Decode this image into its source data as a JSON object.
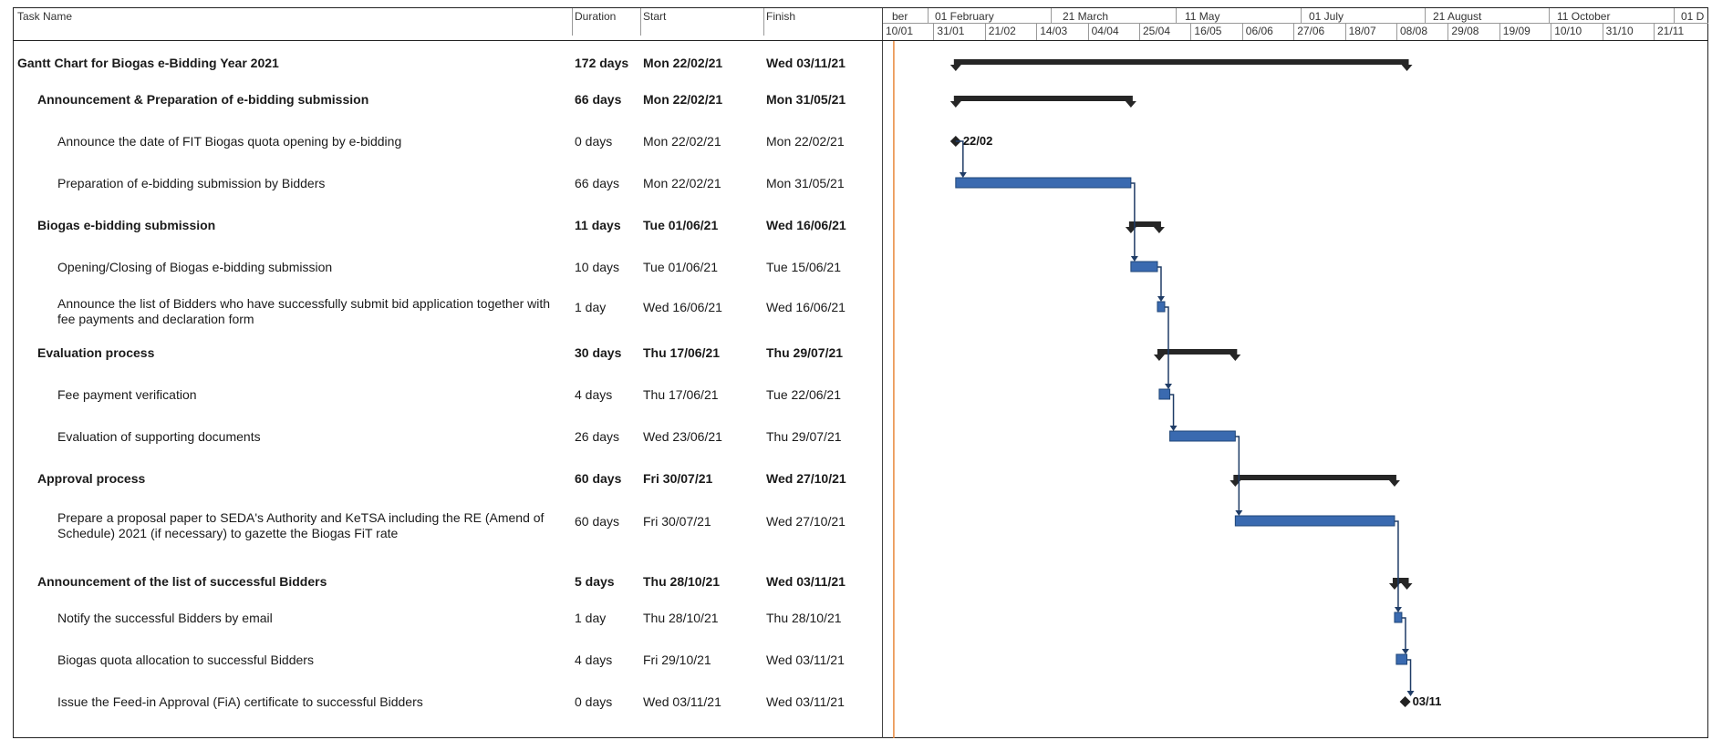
{
  "page_caption": "",
  "columns": {
    "task_name": "Task Name",
    "duration": "Duration",
    "start": "Start",
    "finish": "Finish"
  },
  "timescale": {
    "major": [
      "ber",
      "01 February",
      "21 March",
      "11 May",
      "01 July",
      "21 August",
      "11 October",
      "01 D"
    ],
    "minor": [
      "10/01",
      "31/01",
      "21/02",
      "14/03",
      "04/04",
      "25/04",
      "16/05",
      "06/06",
      "27/06",
      "18/07",
      "08/08",
      "29/08",
      "19/09",
      "10/10",
      "31/10",
      "21/11"
    ]
  },
  "chart_data": {
    "type": "gantt",
    "title": "Gantt Chart for Biogas e-Bidding Year 2021",
    "tasks": [
      {
        "name": "Gantt Chart for Biogas e-Bidding Year 2021",
        "duration": "172 days",
        "start": "Mon 22/02/21",
        "finish": "Wed 03/11/21",
        "level": 0,
        "kind": "summary",
        "start_date": "2021-02-22",
        "finish_date": "2021-11-03"
      },
      {
        "name": "Announcement & Preparation of e-bidding submission",
        "duration": "66 days",
        "start": "Mon 22/02/21",
        "finish": "Mon 31/05/21",
        "level": 1,
        "kind": "summary",
        "start_date": "2021-02-22",
        "finish_date": "2021-05-31"
      },
      {
        "name": "Announce the date of FIT Biogas quota opening by e-bidding",
        "duration": "0 days",
        "start": "Mon 22/02/21",
        "finish": "Mon 22/02/21",
        "level": 2,
        "kind": "milestone",
        "start_date": "2021-02-22",
        "finish_date": "2021-02-22",
        "label": "22/02"
      },
      {
        "name": "Preparation of e-bidding submission by Bidders",
        "duration": "66 days",
        "start": "Mon 22/02/21",
        "finish": "Mon 31/05/21",
        "level": 2,
        "kind": "task",
        "start_date": "2021-02-22",
        "finish_date": "2021-05-31"
      },
      {
        "name": "Biogas e-bidding submission",
        "duration": "11 days",
        "start": "Tue 01/06/21",
        "finish": "Wed 16/06/21",
        "level": 1,
        "kind": "summary",
        "start_date": "2021-06-01",
        "finish_date": "2021-06-16"
      },
      {
        "name": "Opening/Closing of Biogas e-bidding submission",
        "duration": "10 days",
        "start": "Tue 01/06/21",
        "finish": "Tue 15/06/21",
        "level": 2,
        "kind": "task",
        "start_date": "2021-06-01",
        "finish_date": "2021-06-15"
      },
      {
        "name": "Announce the list of Bidders who have successfully submit bid application together with fee payments and declaration form",
        "duration": "1 day",
        "start": "Wed 16/06/21",
        "finish": "Wed 16/06/21",
        "level": 2,
        "kind": "task",
        "start_date": "2021-06-16",
        "finish_date": "2021-06-16"
      },
      {
        "name": "Evaluation process",
        "duration": "30 days",
        "start": "Thu 17/06/21",
        "finish": "Thu 29/07/21",
        "level": 1,
        "kind": "summary",
        "start_date": "2021-06-17",
        "finish_date": "2021-07-29"
      },
      {
        "name": "Fee payment verification",
        "duration": "4 days",
        "start": "Thu 17/06/21",
        "finish": "Tue 22/06/21",
        "level": 2,
        "kind": "task",
        "start_date": "2021-06-17",
        "finish_date": "2021-06-22"
      },
      {
        "name": "Evaluation of supporting documents",
        "duration": "26 days",
        "start": "Wed 23/06/21",
        "finish": "Thu 29/07/21",
        "level": 2,
        "kind": "task",
        "start_date": "2021-06-23",
        "finish_date": "2021-07-29"
      },
      {
        "name": "Approval process",
        "duration": "60 days",
        "start": "Fri 30/07/21",
        "finish": "Wed 27/10/21",
        "level": 1,
        "kind": "summary",
        "start_date": "2021-07-30",
        "finish_date": "2021-10-27"
      },
      {
        "name": "Prepare a proposal paper to SEDA's Authority and KeTSA including the RE (Amend of Schedule) 2021 (if necessary) to gazette the Biogas FiT rate",
        "duration": "60 days",
        "start": "Fri 30/07/21",
        "finish": "Wed 27/10/21",
        "level": 2,
        "kind": "task",
        "start_date": "2021-07-30",
        "finish_date": "2021-10-27"
      },
      {
        "name": "Announcement of the list of successful Bidders",
        "duration": "5 days",
        "start": "Thu 28/10/21",
        "finish": "Wed 03/11/21",
        "level": 1,
        "kind": "summary",
        "start_date": "2021-10-28",
        "finish_date": "2021-11-03"
      },
      {
        "name": "Notify the successful Bidders by email",
        "duration": "1 day",
        "start": "Thu 28/10/21",
        "finish": "Thu 28/10/21",
        "level": 2,
        "kind": "task",
        "start_date": "2021-10-28",
        "finish_date": "2021-10-28"
      },
      {
        "name": "Biogas quota allocation to successful Bidders",
        "duration": "4 days",
        "start": "Fri 29/10/21",
        "finish": "Wed 03/11/21",
        "level": 2,
        "kind": "task",
        "start_date": "2021-10-29",
        "finish_date": "2021-11-03"
      },
      {
        "name": "Issue the Feed-in Approval (FiA) certificate to successful Bidders",
        "duration": "0 days",
        "start": "Wed 03/11/21",
        "finish": "Wed 03/11/21",
        "level": 2,
        "kind": "milestone",
        "start_date": "2021-11-03",
        "finish_date": "2021-11-03",
        "label": "03/11"
      }
    ],
    "status_date": "2021-01-18",
    "colors": {
      "summary": "#262626",
      "task": "#3a6ab0",
      "task_edge": "#1f4678",
      "link": "#1f3c66",
      "status_line": "#e8883c"
    }
  }
}
